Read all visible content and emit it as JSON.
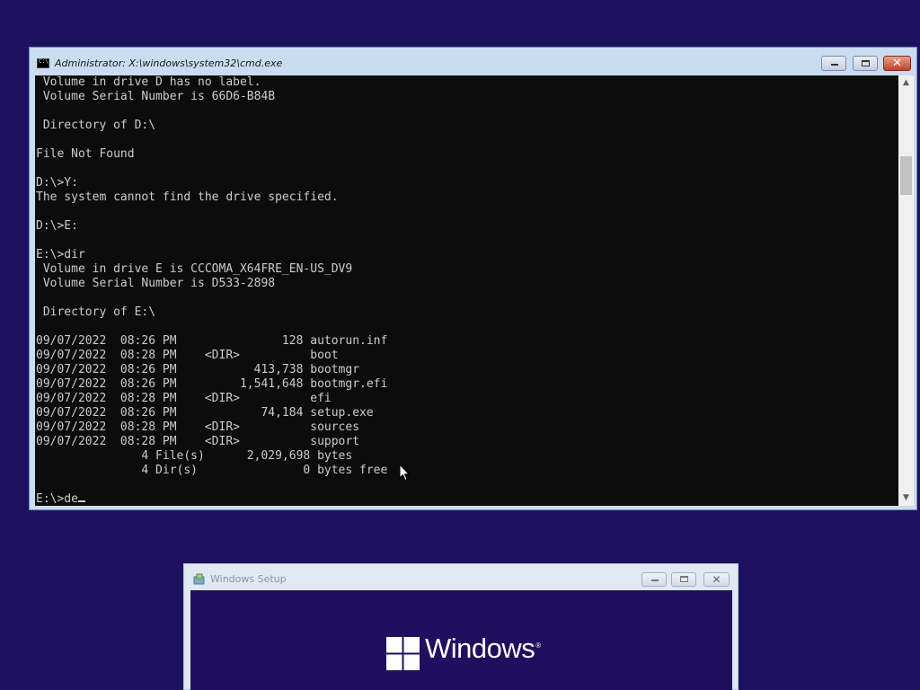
{
  "cmd_window": {
    "title": "Administrator: X:\\windows\\system32\\cmd.exe",
    "controls": {
      "minimize": "minimize",
      "maximize": "maximize",
      "close": "✕"
    },
    "console_lines": [
      " Volume in drive D has no label.",
      " Volume Serial Number is 66D6-B84B",
      "",
      " Directory of D:\\",
      "",
      "File Not Found",
      "",
      "D:\\>Y:",
      "The system cannot find the drive specified.",
      "",
      "D:\\>E:",
      "",
      "E:\\>dir",
      " Volume in drive E is CCCOMA_X64FRE_EN-US_DV9",
      " Volume Serial Number is D533-2898",
      "",
      " Directory of E:\\",
      "",
      "09/07/2022  08:26 PM               128 autorun.inf",
      "09/07/2022  08:28 PM    <DIR>          boot",
      "09/07/2022  08:26 PM           413,738 bootmgr",
      "09/07/2022  08:26 PM         1,541,648 bootmgr.efi",
      "09/07/2022  08:28 PM    <DIR>          efi",
      "09/07/2022  08:26 PM            74,184 setup.exe",
      "09/07/2022  08:28 PM    <DIR>          sources",
      "09/07/2022  08:28 PM    <DIR>          support",
      "               4 File(s)      2,029,698 bytes",
      "               4 Dir(s)               0 bytes free",
      ""
    ],
    "prompt_line": "E:\\>de"
  },
  "setup_window": {
    "title": "Windows Setup",
    "wordmark": "Windows",
    "trademark": "®"
  },
  "colors": {
    "desktop": "#1e1160",
    "console_bg": "#0c0c0c",
    "console_text": "#cccccc",
    "windows_logo": "#ffffff"
  }
}
